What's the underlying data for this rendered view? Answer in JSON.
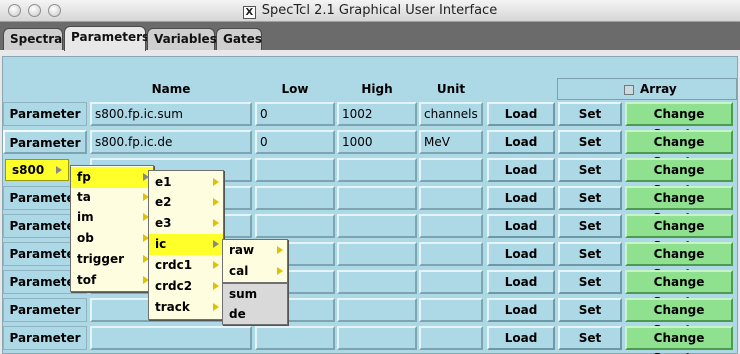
{
  "window": {
    "title": "SpecTcl 2.1 Graphical User Interface"
  },
  "tabs": [
    "Spectra",
    "Parameters",
    "Variables",
    "Gates"
  ],
  "active_tab": "Parameters",
  "headers": {
    "name": "Name",
    "low": "Low",
    "high": "High",
    "unit": "Unit",
    "array": "Array"
  },
  "rows": [
    {
      "label": "Parameter",
      "name": "s800.fp.ic.sum",
      "low": "0",
      "high": "1002",
      "unit": "channels",
      "load": "Load",
      "set": "Set",
      "change": "Change Spectra"
    },
    {
      "label": "Parameter",
      "name": "s800.fp.ic.de",
      "low": "0",
      "high": "1000",
      "unit": "MeV",
      "load": "Load",
      "set": "Set",
      "change": "Change Spectra"
    },
    {
      "label": "s800",
      "name": "",
      "low": "",
      "high": "",
      "unit": "",
      "load": "Load",
      "set": "Set",
      "change": "Change Spectra"
    },
    {
      "label": "Parameter",
      "name": "",
      "low": "",
      "high": "",
      "unit": "",
      "load": "Load",
      "set": "Set",
      "change": "Change Spectra"
    },
    {
      "label": "Parameter",
      "name": "",
      "low": "",
      "high": "",
      "unit": "",
      "load": "Load",
      "set": "Set",
      "change": "Change Spectra"
    },
    {
      "label": "Parameter",
      "name": "",
      "low": "",
      "high": "",
      "unit": "",
      "load": "Load",
      "set": "Set",
      "change": "Change Spectra"
    },
    {
      "label": "Parameter",
      "name": "",
      "low": "",
      "high": "",
      "unit": "",
      "load": "Load",
      "set": "Set",
      "change": "Change Spectra"
    },
    {
      "label": "Parameter",
      "name": "",
      "low": "",
      "high": "",
      "unit": "",
      "load": "Load",
      "set": "Set",
      "change": "Change Spectra"
    },
    {
      "label": "Parameter",
      "name": "",
      "low": "",
      "high": "",
      "unit": "",
      "load": "Load",
      "set": "Set",
      "change": "Change Spectra"
    }
  ],
  "menus": {
    "level1": [
      "fp",
      "ta",
      "im",
      "ob",
      "trigger",
      "tof"
    ],
    "level2": [
      "e1",
      "e2",
      "e3",
      "ic",
      "crdc1",
      "crdc2",
      "track"
    ],
    "level3": [
      "raw",
      "cal",
      "sum",
      "de"
    ]
  },
  "colors": {
    "panel": "#add8e6",
    "change_button": "#8fe08f",
    "menu_highlight": "#ffff2a",
    "menu_bg": "#fffde0"
  }
}
